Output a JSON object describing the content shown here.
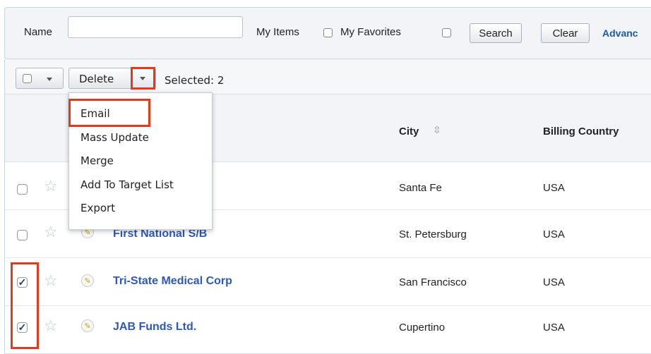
{
  "search": {
    "name_label": "Name",
    "name_value": "",
    "my_items_label": "My Items",
    "my_favorites_label": "My Favorites",
    "search_button": "Search",
    "clear_button": "Clear",
    "advanced_link": "Advanc"
  },
  "actions": {
    "delete_label": "Delete",
    "selected_text": "Selected: 2"
  },
  "dropdown": {
    "items": [
      "Email",
      "Mass Update",
      "Merge",
      "Add To Target List",
      "Export"
    ],
    "highlighted": "Email"
  },
  "table": {
    "columns": {
      "city": "City",
      "city_sort_icon": "sort-icon",
      "country": "Billing Country"
    },
    "rows": [
      {
        "name": "",
        "city": "Santa Fe",
        "country": "USA",
        "checked": false
      },
      {
        "name": "First National S/B",
        "city": "St. Petersburg",
        "country": "USA",
        "checked": false
      },
      {
        "name": "Tri-State Medical Corp",
        "city": "San Francisco",
        "country": "USA",
        "checked": true
      },
      {
        "name": "JAB Funds Ltd.",
        "city": "Cupertino",
        "country": "USA",
        "checked": true
      }
    ]
  },
  "colors": {
    "highlight": "#e33a1e",
    "link": "#2f58b8",
    "header_bg": "#f2f4f7"
  }
}
